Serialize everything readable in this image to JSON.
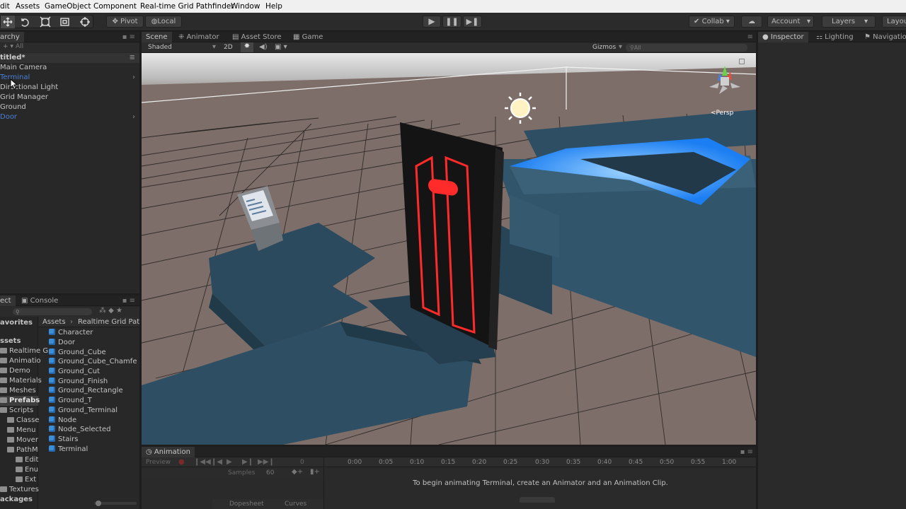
{
  "menubar": {
    "items": [
      "dit",
      "Assets",
      "GameObject",
      "Component",
      "Real-time Grid Pathfinder",
      "Window",
      "Help"
    ]
  },
  "toolbar": {
    "pivot": "Pivot",
    "local": "Local",
    "collab": "Collab ▾",
    "account": "Account",
    "layers": "Layers",
    "layout": "Layou"
  },
  "hierarchy": {
    "tab": "archy",
    "create": "+ ▾",
    "search_placeholder": "All",
    "scene_name": "titled*",
    "items": [
      {
        "label": "Main Camera",
        "color": "default"
      },
      {
        "label": "Terminal",
        "color": "blue"
      },
      {
        "label": "Directional Light",
        "color": "default"
      },
      {
        "label": "Grid Manager",
        "color": "default"
      },
      {
        "label": "Ground",
        "color": "default"
      },
      {
        "label": "Door",
        "color": "blue"
      }
    ]
  },
  "scene_view": {
    "tabs": [
      "Scene",
      "Animator",
      "Asset Store",
      "Game"
    ],
    "shading": "Shaded",
    "mode_2d": "2D",
    "gizmos": "Gizmos",
    "search_placeholder": "All",
    "persp": "Persp"
  },
  "inspector": {
    "tabs": [
      "Inspector",
      "Lighting",
      "Navigatio"
    ]
  },
  "project": {
    "tabs": [
      "ect",
      "Console"
    ],
    "favorites": "avorites",
    "assets_root": "ssets",
    "tree": [
      {
        "label": "Realtime G",
        "indent": 0
      },
      {
        "label": "Animatio",
        "indent": 1
      },
      {
        "label": "Demo",
        "indent": 1
      },
      {
        "label": "Materials",
        "indent": 1
      },
      {
        "label": "Meshes",
        "indent": 1
      },
      {
        "label": "Prefabs",
        "indent": 1,
        "selected": true
      },
      {
        "label": "Scripts",
        "indent": 1
      },
      {
        "label": "Classe",
        "indent": 2
      },
      {
        "label": "Menu",
        "indent": 2
      },
      {
        "label": "Mover",
        "indent": 2
      },
      {
        "label": "PathM",
        "indent": 2
      },
      {
        "label": "Edit",
        "indent": 3
      },
      {
        "label": "Enu",
        "indent": 3
      },
      {
        "label": "Ext",
        "indent": 3
      },
      {
        "label": "Textures",
        "indent": 1
      }
    ],
    "packages": "ackages",
    "breadcrumb": [
      "Assets",
      "Realtime Grid Pat"
    ],
    "assets": [
      "Character",
      "Door",
      "Ground_Cube",
      "Ground_Cube_Chamfe",
      "Ground_Cut",
      "Ground_Finish",
      "Ground_Rectangle",
      "Ground_T",
      "Ground_Terminal",
      "Node",
      "Node_Selected",
      "Stairs",
      "Terminal"
    ]
  },
  "animation": {
    "tab": "Animation",
    "preview": "Preview",
    "samples_label": "Samples",
    "samples_value": "60",
    "frame": "0",
    "ruler": [
      "0:00",
      "0:05",
      "0:10",
      "0:15",
      "0:20",
      "0:25",
      "0:30",
      "0:35",
      "0:40",
      "0:45",
      "0:50",
      "0:55",
      "1:00"
    ],
    "message": "To begin animating Terminal, create an Animator and an Animation Clip.",
    "bottom_tabs": [
      "Dopesheet",
      "Curves"
    ]
  },
  "colors": {
    "accent_blue": "#4a7fd6",
    "door_red": "#ff2a2a",
    "ground_blue": "#2e4f63",
    "water_blue": "#3aa0ff"
  }
}
